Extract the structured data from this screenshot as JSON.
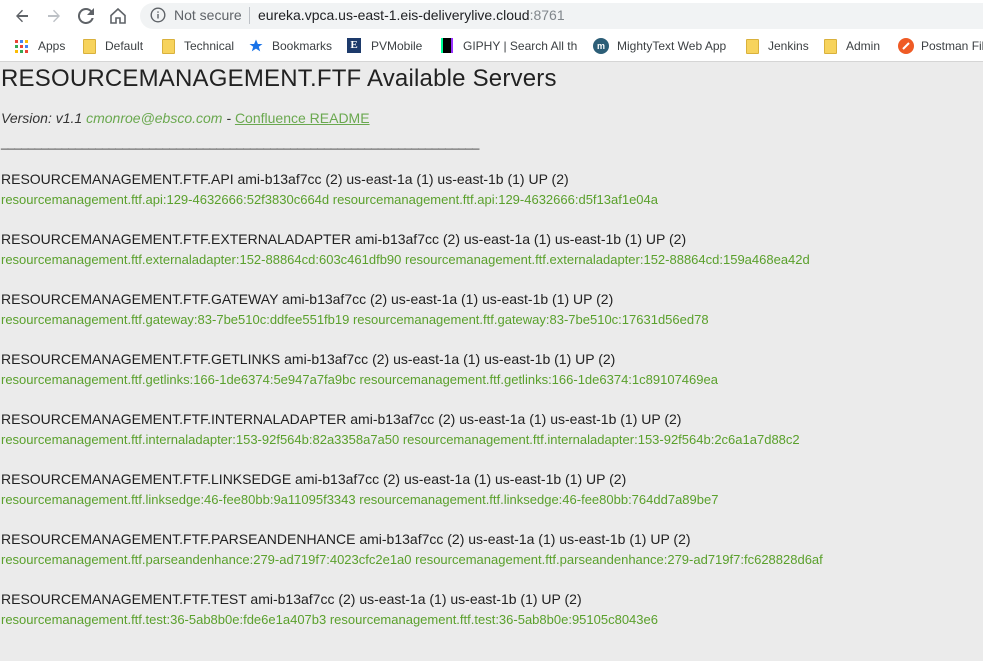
{
  "browser": {
    "not_secure": "Not secure",
    "url_host": "eureka.vpca.us-east-1.eis-deliverylive.cloud",
    "url_port": ":8761"
  },
  "bookmarks": [
    {
      "label": "Apps",
      "icon": "apps-grid-icon"
    },
    {
      "label": "Default",
      "icon": "folder-icon"
    },
    {
      "label": "Technical",
      "icon": "folder-icon"
    },
    {
      "label": "Bookmarks",
      "icon": "star-icon"
    },
    {
      "label": "PVMobile",
      "icon": "e-logo-icon"
    },
    {
      "label": "GIPHY | Search All the",
      "icon": "giphy-icon"
    },
    {
      "label": "MightyText Web App",
      "icon": "mightytext-icon"
    },
    {
      "label": "Jenkins",
      "icon": "folder-icon"
    },
    {
      "label": "Admin",
      "icon": "folder-icon"
    },
    {
      "label": "Postman Fil",
      "icon": "postman-icon"
    }
  ],
  "page": {
    "title": "RESOURCEMANAGEMENT.FTF Available Servers",
    "version_text": "Version: v1.1",
    "email": "cmonroe@ebsco.com",
    "dash": " - ",
    "readme_link": "Confluence README",
    "rule": "_______________________________________________________________________"
  },
  "services": [
    {
      "header": "RESOURCEMANAGEMENT.FTF.API ami-b13af7cc (2) us-east-1a (1) us-east-1b (1) UP (2)",
      "instances": "resourcemanagement.ftf.api:129-4632666:52f3830c664d resourcemanagement.ftf.api:129-4632666:d5f13af1e04a"
    },
    {
      "header": "RESOURCEMANAGEMENT.FTF.EXTERNALADAPTER ami-b13af7cc (2) us-east-1a (1) us-east-1b (1) UP (2)",
      "instances": "resourcemanagement.ftf.externaladapter:152-88864cd:603c461dfb90 resourcemanagement.ftf.externaladapter:152-88864cd:159a468ea42d"
    },
    {
      "header": "RESOURCEMANAGEMENT.FTF.GATEWAY ami-b13af7cc (2) us-east-1a (1) us-east-1b (1) UP (2)",
      "instances": "resourcemanagement.ftf.gateway:83-7be510c:ddfee551fb19 resourcemanagement.ftf.gateway:83-7be510c:17631d56ed78"
    },
    {
      "header": "RESOURCEMANAGEMENT.FTF.GETLINKS ami-b13af7cc (2) us-east-1a (1) us-east-1b (1) UP (2)",
      "instances": "resourcemanagement.ftf.getlinks:166-1de6374:5e947a7fa9bc resourcemanagement.ftf.getlinks:166-1de6374:1c89107469ea"
    },
    {
      "header": "RESOURCEMANAGEMENT.FTF.INTERNALADAPTER ami-b13af7cc (2) us-east-1a (1) us-east-1b (1) UP (2)",
      "instances": "resourcemanagement.ftf.internaladapter:153-92f564b:82a3358a7a50 resourcemanagement.ftf.internaladapter:153-92f564b:2c6a1a7d88c2"
    },
    {
      "header": "RESOURCEMANAGEMENT.FTF.LINKSEDGE ami-b13af7cc (2) us-east-1a (1) us-east-1b (1) UP (2)",
      "instances": "resourcemanagement.ftf.linksedge:46-fee80bb:9a11095f3343 resourcemanagement.ftf.linksedge:46-fee80bb:764dd7a89be7"
    },
    {
      "header": "RESOURCEMANAGEMENT.FTF.PARSEANDENHANCE ami-b13af7cc (2) us-east-1a (1) us-east-1b (1) UP (2)",
      "instances": "resourcemanagement.ftf.parseandenhance:279-ad719f7:4023cfc2e1a0 resourcemanagement.ftf.parseandenhance:279-ad719f7:fc628828d6af"
    },
    {
      "header": "RESOURCEMANAGEMENT.FTF.TEST ami-b13af7cc (2) us-east-1a (1) us-east-1b (1) UP (2)",
      "instances": "resourcemanagement.ftf.test:36-5ab8b0e:fde6e1a407b3 resourcemanagement.ftf.test:36-5ab8b0e:95105c8043e6"
    }
  ]
}
